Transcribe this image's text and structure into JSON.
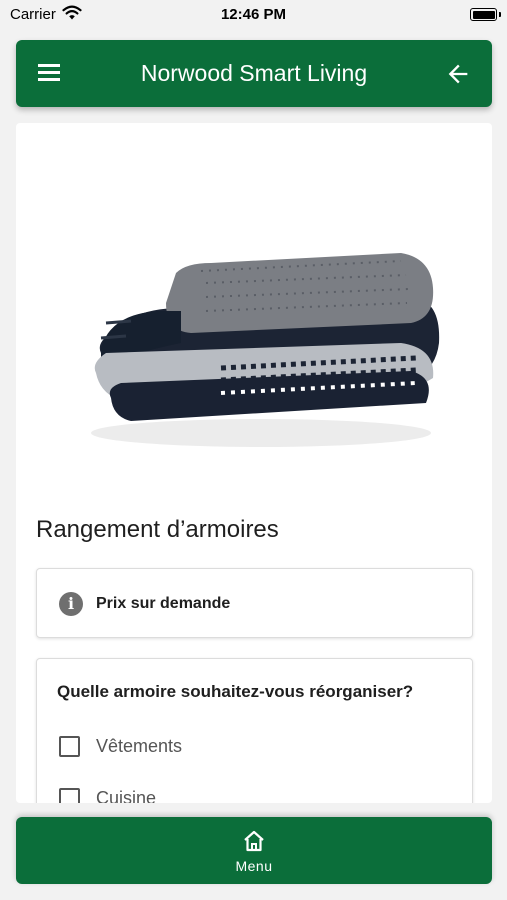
{
  "status_bar": {
    "carrier": "Carrier",
    "time": "12:46 PM"
  },
  "app_bar": {
    "title": "Norwood Smart Living",
    "menu_icon": "hamburger-icon",
    "back_icon": "arrow-left-icon"
  },
  "product": {
    "image": "folded-socks-image",
    "title": "Rangement d’armoires",
    "price_text": "Prix sur demande",
    "info_icon": "info-icon"
  },
  "question": {
    "text": "Quelle armoire souhaitez-vous réorganiser?",
    "options": [
      {
        "label": "Vêtements",
        "checked": false
      },
      {
        "label": "Cuisine",
        "checked": false
      }
    ]
  },
  "bottom_nav": {
    "label": "Menu",
    "icon": "home-icon"
  },
  "colors": {
    "primary": "#0b6e3a",
    "background": "#f2f2f2",
    "card": "#ffffff"
  }
}
